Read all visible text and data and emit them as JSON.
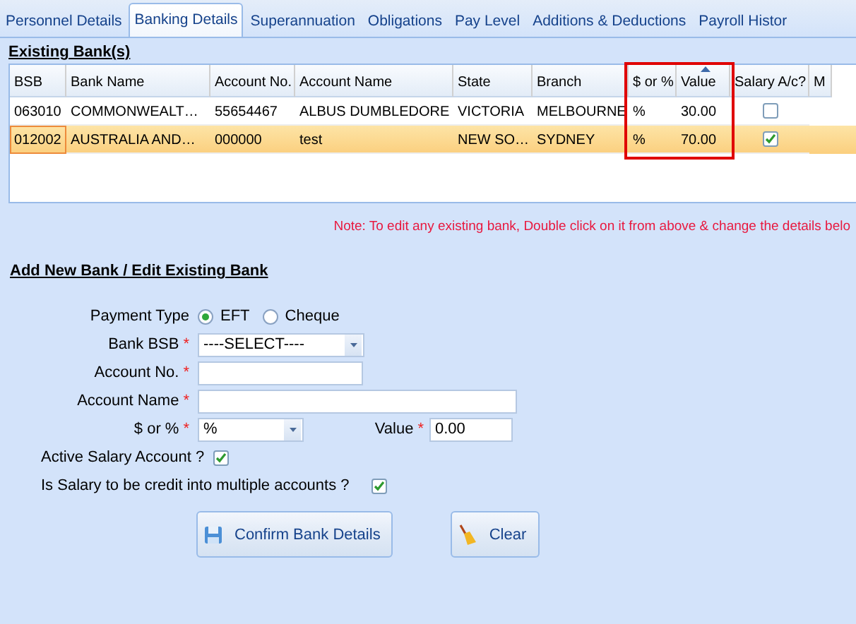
{
  "tabs": [
    {
      "label": "Personnel Details",
      "selected": false
    },
    {
      "label": "Banking Details",
      "selected": true
    },
    {
      "label": "Superannuation",
      "selected": false
    },
    {
      "label": "Obligations",
      "selected": false
    },
    {
      "label": "Pay Level",
      "selected": false
    },
    {
      "label": "Additions & Deductions",
      "selected": false
    },
    {
      "label": "Payroll Histor",
      "selected": false
    }
  ],
  "existing_banks": {
    "title": "Existing Bank(s)",
    "columns": [
      {
        "label": "BSB",
        "highlighted": false,
        "sorted": false
      },
      {
        "label": "Bank Name",
        "highlighted": false,
        "sorted": false
      },
      {
        "label": "Account No.",
        "highlighted": false,
        "sorted": false
      },
      {
        "label": "Account Name",
        "highlighted": false,
        "sorted": false
      },
      {
        "label": "State",
        "highlighted": false,
        "sorted": false
      },
      {
        "label": "Branch",
        "highlighted": false,
        "sorted": false
      },
      {
        "label": "$ or %",
        "highlighted": true,
        "sorted": false
      },
      {
        "label": "Value",
        "highlighted": true,
        "sorted": true
      },
      {
        "label": "Salary A/c?",
        "highlighted": false,
        "sorted": false
      },
      {
        "label": "M",
        "highlighted": false,
        "sorted": false
      }
    ],
    "rows": [
      {
        "cells": [
          "063010",
          "COMMONWEALT…",
          "55654467",
          "ALBUS DUMBLEDORE",
          "VICTORIA",
          "MELBOURNE",
          "%",
          "30.00"
        ],
        "salary_account": false,
        "selected": false,
        "focused": false
      },
      {
        "cells": [
          "012002",
          "AUSTRALIA AND…",
          "000000",
          "test",
          "NEW SO…",
          "SYDNEY",
          "%",
          "70.00"
        ],
        "salary_account": true,
        "selected": true,
        "focused": true
      }
    ]
  },
  "note": "Note: To edit any existing bank, Double click on it from above & change the details belo",
  "form": {
    "title": "Add New Bank / Edit Existing Bank",
    "payment_type": {
      "label": "Payment Type",
      "options": [
        {
          "label": "EFT",
          "selected": true
        },
        {
          "label": "Cheque",
          "selected": false
        }
      ]
    },
    "bank_bsb": {
      "label": "Bank BSB",
      "mark": "*",
      "value": "----SELECT----"
    },
    "account_no": {
      "label": "Account No.",
      "mark": "*"
    },
    "account_name": {
      "label": "Account Name",
      "mark": "*"
    },
    "type": {
      "label": "$ or %",
      "mark": "*",
      "value": "%"
    },
    "value": {
      "label": "Value",
      "mark": "*",
      "value": "0.00"
    },
    "active_salary": {
      "label": "Active Salary Account ?",
      "checked": true
    },
    "multiple_accounts": {
      "label": "Is Salary to be credit into multiple accounts ?",
      "checked": true
    }
  },
  "buttons": [
    {
      "label": "Confirm Bank Details",
      "kind": "confirm"
    },
    {
      "label": "Clear",
      "kind": "clear"
    }
  ]
}
